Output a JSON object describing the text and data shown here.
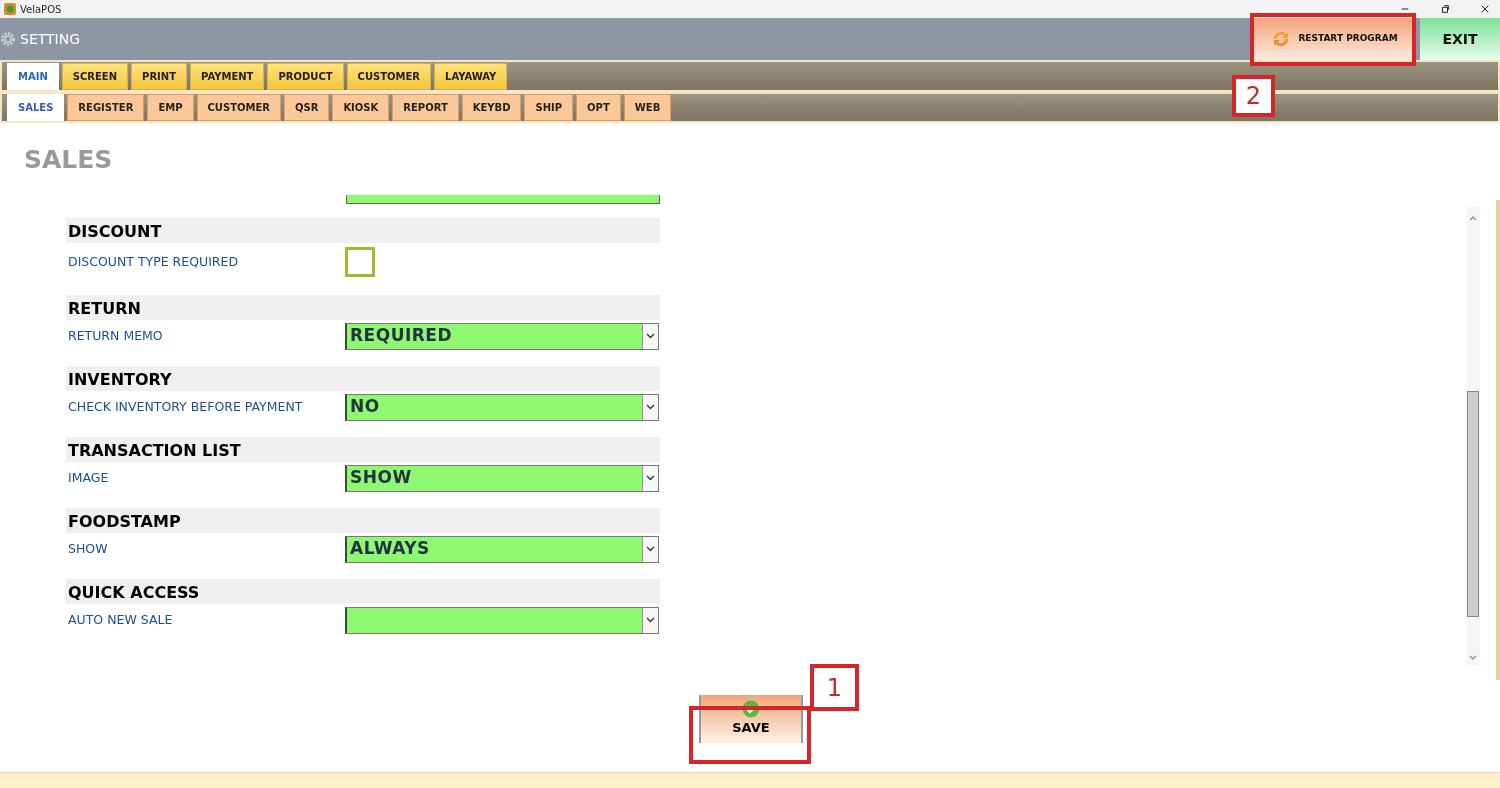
{
  "window": {
    "title": "VelaPOS"
  },
  "header": {
    "title": "SETTING",
    "restart_button": "RESTART PROGRAM",
    "restart_callout": "2",
    "exit_button": "EXIT"
  },
  "main_tabs": [
    {
      "label": "MAIN",
      "selected": true
    },
    {
      "label": "SCREEN",
      "selected": false
    },
    {
      "label": "PRINT",
      "selected": false
    },
    {
      "label": "PAYMENT",
      "selected": false
    },
    {
      "label": "PRODUCT",
      "selected": false
    },
    {
      "label": "CUSTOMER",
      "selected": false
    },
    {
      "label": "LAYAWAY",
      "selected": false
    }
  ],
  "sub_tabs": [
    {
      "label": "SALES",
      "selected": true
    },
    {
      "label": "REGISTER",
      "selected": false
    },
    {
      "label": "EMP",
      "selected": false
    },
    {
      "label": "CUSTOMER",
      "selected": false
    },
    {
      "label": "QSR",
      "selected": false
    },
    {
      "label": "KIOSK",
      "selected": false
    },
    {
      "label": "REPORT",
      "selected": false
    },
    {
      "label": "KEYBD",
      "selected": false
    },
    {
      "label": "SHIP",
      "selected": false
    },
    {
      "label": "OPT",
      "selected": false
    },
    {
      "label": "WEB",
      "selected": false
    }
  ],
  "page_title": "SALES",
  "sections": [
    {
      "title": "DISCOUNT",
      "settings": [
        {
          "kind": "checkbox",
          "label": "DISCOUNT TYPE REQUIRED",
          "checked": false
        }
      ]
    },
    {
      "title": "RETURN",
      "settings": [
        {
          "kind": "select",
          "label": "RETURN MEMO",
          "value": "REQUIRED"
        }
      ]
    },
    {
      "title": "INVENTORY",
      "settings": [
        {
          "kind": "select",
          "label": "CHECK INVENTORY BEFORE PAYMENT",
          "value": "NO"
        }
      ]
    },
    {
      "title": "TRANSACTION LIST",
      "settings": [
        {
          "kind": "select",
          "label": "IMAGE",
          "value": "SHOW"
        }
      ]
    },
    {
      "title": "FOODSTAMP",
      "settings": [
        {
          "kind": "select",
          "label": "SHOW",
          "value": "ALWAYS"
        }
      ]
    },
    {
      "title": "QUICK ACCESS",
      "settings": [
        {
          "kind": "select",
          "label": "AUTO NEW SALE"
        }
      ]
    }
  ],
  "save_button": "SAVE",
  "save_callout": "1"
}
